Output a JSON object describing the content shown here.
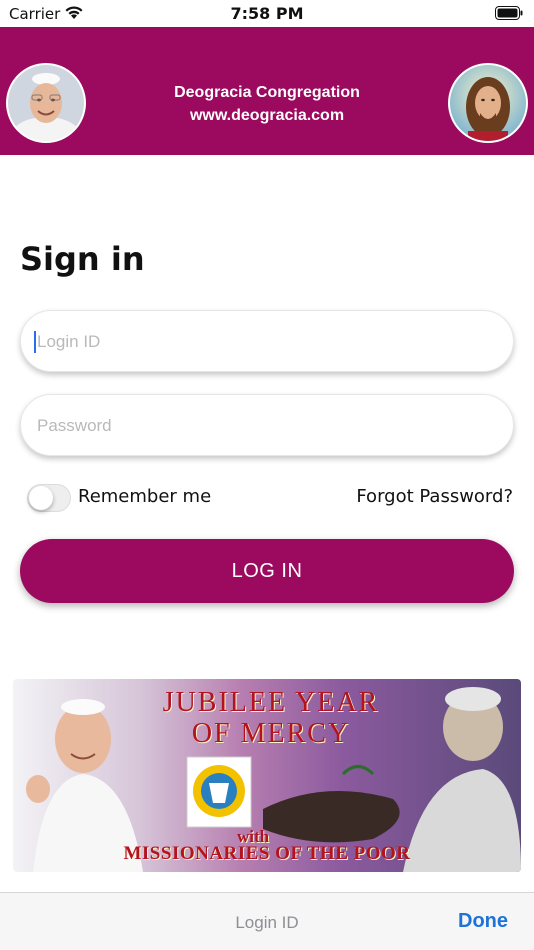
{
  "status_bar": {
    "carrier": "Carrier",
    "time": "7:58 PM",
    "wifi_icon": "wifi-icon",
    "battery_icon": "battery-icon"
  },
  "header": {
    "title": "Deogracia Congregation",
    "website": "www.deogracia.com",
    "background_color": "#9c0a5f",
    "left_avatar": "pope-avatar",
    "right_avatar": "jesus-avatar"
  },
  "form": {
    "title": "Sign in",
    "login_placeholder": "Login ID",
    "password_placeholder": "Password",
    "remember_label": "Remember me",
    "remember_checked": false,
    "forgot_label": "Forgot Password?",
    "login_button": "LOG IN"
  },
  "banner": {
    "title_line1": "JUBILEE YEAR",
    "title_line2": "OF MERCY",
    "with": "with",
    "subtitle": "MISSIONARIES OF THE POOR"
  },
  "keyboard_accessory": {
    "field_label": "Login ID",
    "done_label": "Done"
  }
}
